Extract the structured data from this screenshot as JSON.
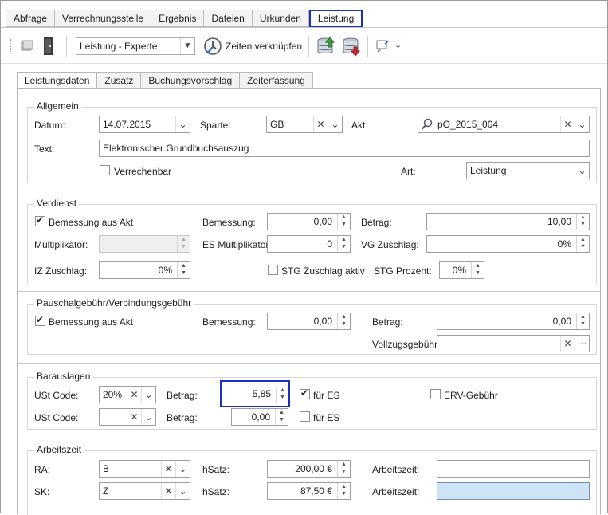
{
  "top_tabs": [
    "Abfrage",
    "Verrechnungsstelle",
    "Ergebnis",
    "Dateien",
    "Urkunden",
    "Leistung"
  ],
  "toolbar": {
    "mode_select": "Leistung - Experte",
    "link_times_label": "Zeiten verknüpfen"
  },
  "inner_tabs": [
    "Leistungsdaten",
    "Zusatz",
    "Buchungsvorschlag",
    "Zeiterfassung"
  ],
  "allgemein": {
    "title": "Allgemein",
    "datum_label": "Datum:",
    "datum_value": "14.07.2015",
    "sparte_label": "Sparte:",
    "sparte_value": "GB",
    "akt_label": "Akt:",
    "akt_value": "pO_2015_004",
    "text_label": "Text:",
    "text_value": "Elektronischer Grundbuchsauszug",
    "verrechenbar_label": "Verrechenbar",
    "art_label": "Art:",
    "art_value": "Leistung"
  },
  "verdienst": {
    "title": "Verdienst",
    "bemessung_aus_akt_label": "Bemessung aus Akt",
    "bemessung_label": "Bemessung:",
    "bemessung_value": "0,00",
    "betrag_label": "Betrag:",
    "betrag_value": "10,00",
    "multiplikator_label": "Multiplikator:",
    "multiplikator_value": "",
    "es_multiplikator_label": "ES Multiplikator:",
    "es_multiplikator_value": "0",
    "vg_zuschlag_label": "VG Zuschlag:",
    "vg_zuschlag_value": "0%",
    "iz_zuschlag_label": "IZ Zuschlag:",
    "iz_zuschlag_value": "0%",
    "stg_zuschlag_aktiv_label": "STG Zuschlag aktiv",
    "stg_prozent_label": "STG Prozent:",
    "stg_prozent_value": "0%"
  },
  "pauschal": {
    "title": "Pauschalgebühr/Verbindungsgebühr",
    "bemessung_aus_akt_label": "Bemessung aus Akt",
    "bemessung_label": "Bemessung:",
    "bemessung_value": "0,00",
    "betrag_label": "Betrag:",
    "betrag_value": "0,00",
    "vollzugsgebuehr_label": "Vollzugsgebühr:",
    "vollzugsgebuehr_value": ""
  },
  "barauslagen": {
    "title": "Barauslagen",
    "ust_code_label": "USt Code:",
    "row1_ust_value": "20%",
    "betrag_label": "Betrag:",
    "row1_betrag_value": "5,85",
    "fuer_es_label": "für ES",
    "erv_gebuehr_label": "ERV-Gebühr",
    "row2_ust_value": "",
    "row2_betrag_value": "0,00"
  },
  "arbeitszeit": {
    "title": "Arbeitszeit",
    "ra_label": "RA:",
    "ra_value": "B",
    "sk_label": "SK:",
    "sk_value": "Z",
    "hsatz_label": "hSatz:",
    "ra_hsatz_value": "200,00 €",
    "sk_hsatz_value": "87,50 €",
    "arbeitszeit_label": "Arbeitszeit:",
    "ra_arbeitszeit_value": "",
    "sk_arbeitszeit_value": ""
  }
}
